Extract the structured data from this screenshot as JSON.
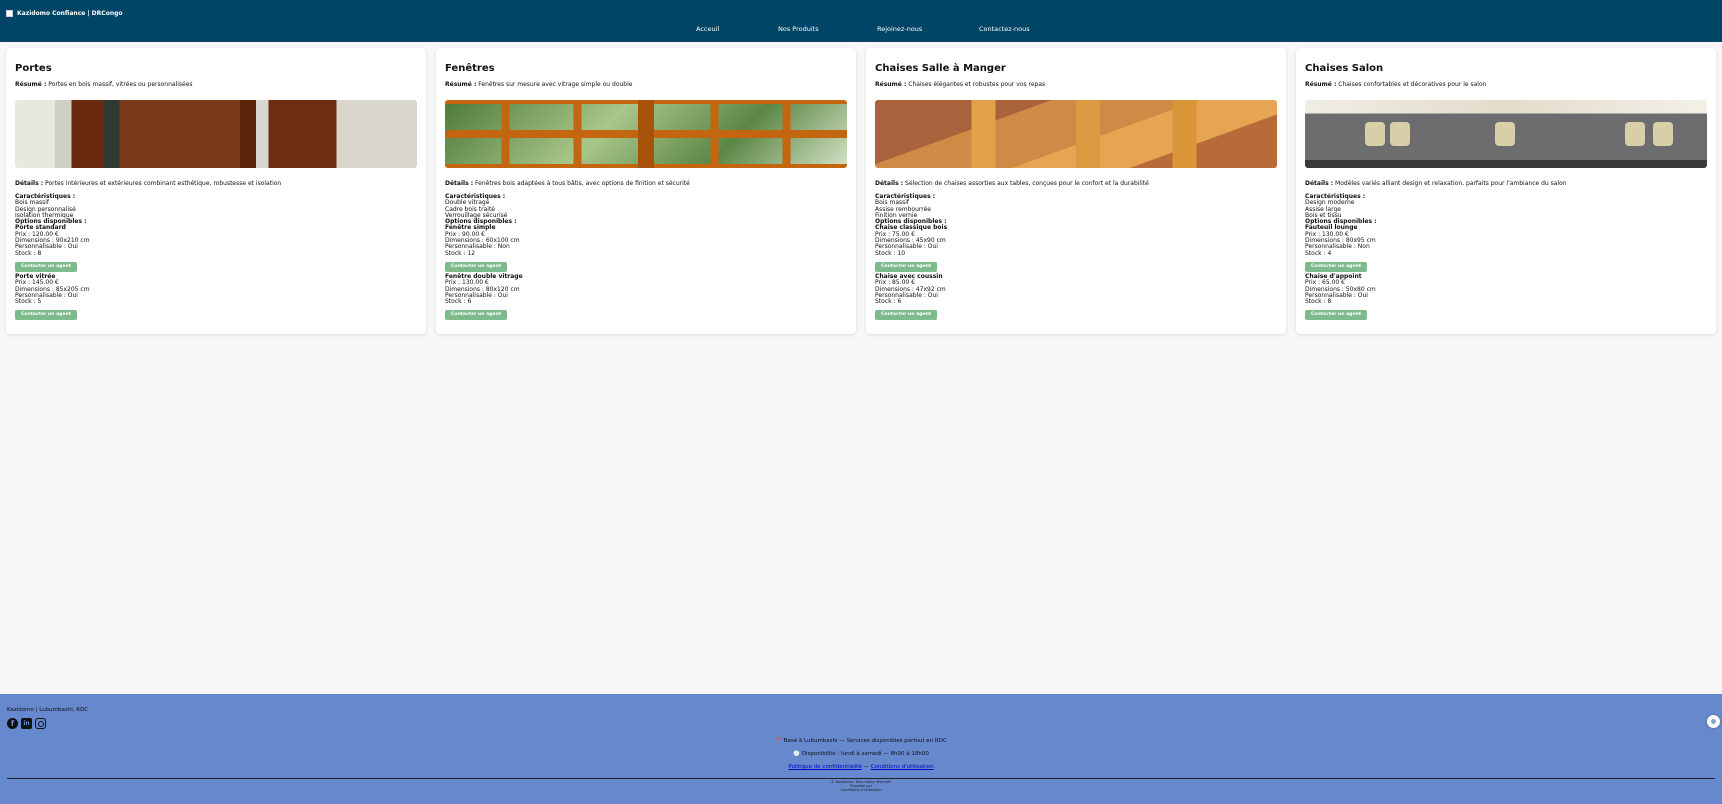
{
  "header": {
    "brand": "Kazidomo Confiance | DRCongo",
    "nav": [
      "Acceuil",
      "Nos Produits",
      "Rejoinez-nous",
      "Contactez-nous"
    ]
  },
  "cards": [
    {
      "title": "Portes",
      "summary_label": "Résumé :",
      "summary": " Portes en bois massif, vitrées ou personnalisées",
      "details_label": "Détails :",
      "details": " Portes intérieures et extérieures combinant esthétique, robustesse et isolation",
      "features_label": "Caractéristiques :",
      "features": [
        "Bois massif",
        "Design personnalisé",
        "Isolation thermique"
      ],
      "options_label": "Options disponibles :",
      "options": [
        {
          "name": "Porte standard",
          "price": "Prix : 120.00 €",
          "dimensions": "Dimensions : 90x210 cm",
          "custom": "Personnalisable : Oui",
          "stock": "Stock : 8"
        },
        {
          "name": "Porte vitrée",
          "price": "Prix : 145.00 €",
          "dimensions": "Dimensions : 85x205 cm",
          "custom": "Personnalisable : Oui",
          "stock": "Stock : 5"
        }
      ]
    },
    {
      "title": "Fenêtres",
      "summary_label": "Résumé :",
      "summary": " Fenêtres sur mesure avec vitrage simple ou double",
      "details_label": "Détails :",
      "details": " Fenêtres bois adaptées à tous bâtis, avec options de finition et sécurité",
      "features_label": "Caractéristiques :",
      "features": [
        "Double vitrage",
        "Cadre bois traité",
        "Verrouillage sécurisé"
      ],
      "options_label": "Options disponibles :",
      "options": [
        {
          "name": "Fenêtre simple",
          "price": "Prix : 90.00 €",
          "dimensions": "Dimensions : 60x100 cm",
          "custom": "Personnalisable : Non",
          "stock": "Stock : 12"
        },
        {
          "name": "Fenêtre double vitrage",
          "price": "Prix : 130.00 €",
          "dimensions": "Dimensions : 80x120 cm",
          "custom": "Personnalisable : Oui",
          "stock": "Stock : 6"
        }
      ]
    },
    {
      "title": "Chaises Salle à Manger",
      "summary_label": "Résumé :",
      "summary": " Chaises élégantes et robustes pour vos repas",
      "details_label": "Détails :",
      "details": " Sélection de chaises assorties aux tables, conçues pour le confort et la durabilité",
      "features_label": "Caractéristiques :",
      "features": [
        "Bois massif",
        "Assise rembourrée",
        "Finition vernie"
      ],
      "options_label": "Options disponibles :",
      "options": [
        {
          "name": "Chaise classique bois",
          "price": "Prix : 75.00 €",
          "dimensions": "Dimensions : 45x90 cm",
          "custom": "Personnalisable : Oui",
          "stock": "Stock : 10"
        },
        {
          "name": "Chaise avec coussin",
          "price": "Prix : 85.00 €",
          "dimensions": "Dimensions : 47x92 cm",
          "custom": "Personnalisable : Oui",
          "stock": "Stock : 6"
        }
      ]
    },
    {
      "title": "Chaises Salon",
      "summary_label": "Résumé :",
      "summary": " Chaises confortables et décoratives pour le salon",
      "details_label": "Détails :",
      "details": " Modèles variés alliant design et relaxation, parfaits pour l'ambiance du salon",
      "features_label": "Caractéristiques :",
      "features": [
        "Design moderne",
        "Assise large",
        "Bois et tissu"
      ],
      "options_label": "Options disponibles :",
      "options": [
        {
          "name": "Fauteuil lounge",
          "price": "Prix : 130.00 €",
          "dimensions": "Dimensions : 80x95 cm",
          "custom": "Personnalisable : Non",
          "stock": "Stock : 4"
        },
        {
          "name": "Chaise d'appoint",
          "price": "Prix : 65.00 €",
          "dimensions": "Dimensions : 50x80 cm",
          "custom": "Personnalisable : Oui",
          "stock": "Stock : 8"
        }
      ]
    }
  ],
  "button_label": "Contacter un agent",
  "footer": {
    "brand": "Kazidomo | Lubumbashi, RDC",
    "location": "📍 Basé à Lubumbashi — Services disponibles partout en RDC",
    "availability": "🕘 Disponibilité : lundi à samedi — 8h00 à 18h00",
    "privacy": "Politique de confidentialité",
    "separator": " — ",
    "terms": "Conditions d'utilisation",
    "copyright": "© Kazidomo. Tous droits réservés",
    "fine1": "Propulsé par",
    "fine2": "Conditions d'utilisation"
  },
  "colors": {
    "header": "#004466",
    "button": "#7dbb8c",
    "footer": "#6688cc",
    "link": "#0000cc"
  }
}
